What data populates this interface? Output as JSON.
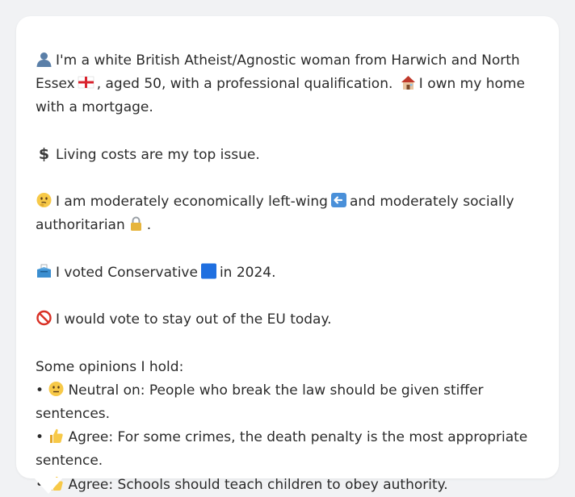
{
  "profile": {
    "identity_prefix": "I'm a white British Atheist/Agnostic woman from Harwich and North Essex",
    "identity_suffix": ", aged 50, with a professional qualification.",
    "home": "I own my home with a mortgage.",
    "top_issue": "Living costs are my top issue.",
    "position_a": "I am moderately economically left-wing",
    "position_b": "and moderately socially authoritarian",
    "position_end": ".",
    "vote_prefix": "I voted Conservative",
    "vote_suffix": "in 2024.",
    "eu": "I would vote to stay out of the EU today."
  },
  "opinions": {
    "heading": "Some opinions I hold:",
    "items": [
      {
        "bullet": "•",
        "stance": "Neutral on:",
        "text": "People who break the law should be given stiffer sentences.",
        "icon": "neutral-face-icon"
      },
      {
        "bullet": "•",
        "stance": "Agree:",
        "text": "For some crimes, the death penalty is the most appropriate sentence.",
        "icon": "thumbs-up-icon"
      },
      {
        "bullet": "•",
        "stance": "Agree:",
        "text": "Schools should teach children to obey authority.",
        "icon": "thumbs-up-icon"
      }
    ]
  },
  "icons": {
    "person": "bust-silhouette-icon",
    "flag": "england-flag-icon",
    "house": "house-icon",
    "money": "dollar-sign-icon",
    "thinking": "thinking-face-icon",
    "left_arrow": "left-arrow-icon",
    "lock": "lock-icon",
    "ballot": "ballot-box-icon",
    "party_square": "blue-square-icon",
    "prohibited": "prohibited-icon"
  },
  "colors": {
    "background": "#f1f2f4",
    "card": "#ffffff",
    "text": "#2b2b2b",
    "conservative_blue": "#1f6fe0"
  }
}
